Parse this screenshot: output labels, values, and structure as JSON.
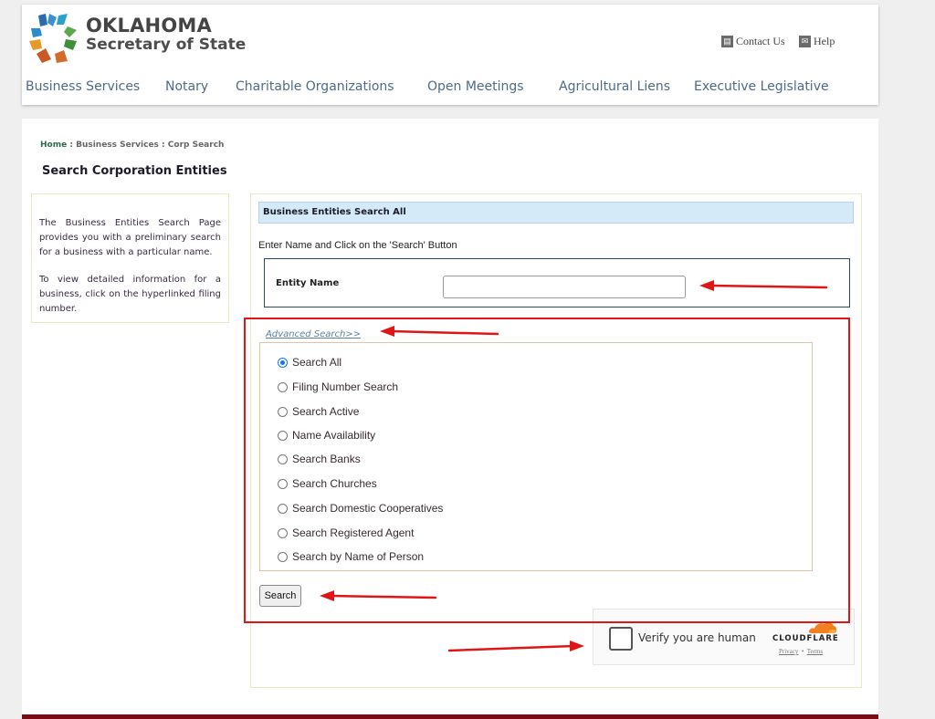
{
  "header": {
    "brand_line1": "OKLAHOMA",
    "brand_line2": "Secretary of State",
    "utility_links": [
      {
        "label": "Contact Us",
        "icon": "contact-icon"
      },
      {
        "label": "Help",
        "icon": "mail-icon"
      }
    ],
    "nav": [
      "Business Services",
      "Notary",
      "Charitable Organizations",
      "Open Meetings",
      "Agricultural Liens",
      "Executive Legislative"
    ]
  },
  "breadcrumb": {
    "home": "Home",
    "sep": " : ",
    "section": "Business Services",
    "current": "Corp Search"
  },
  "page_title": "Search Corporation Entities",
  "sidebar": {
    "para1": "The Business Entities Search Page provides you with a preliminary search for a business with a particular name.",
    "para2": "To view detailed information for a business, click on the hyperlinked filing number."
  },
  "search_panel": {
    "heading": "Business Entities Search All",
    "instructions": "Enter Name and Click on the 'Search' Button",
    "entity_label": "Entity Name",
    "entity_value": "",
    "advanced_link": "Advanced Search>>",
    "options": [
      {
        "label": "Search All",
        "selected": true
      },
      {
        "label": "Filing Number Search",
        "selected": false
      },
      {
        "label": "Search Active",
        "selected": false
      },
      {
        "label": "Name Availability",
        "selected": false
      },
      {
        "label": "Search Banks",
        "selected": false
      },
      {
        "label": "Search Churches",
        "selected": false
      },
      {
        "label": "Search Domestic Cooperatives",
        "selected": false
      },
      {
        "label": "Search Registered Agent",
        "selected": false
      },
      {
        "label": "Search by Name of Person",
        "selected": false
      }
    ],
    "search_button": "Search"
  },
  "captcha": {
    "label": "Verify you are human",
    "provider": "CLOUDFLARE",
    "privacy": "Privacy",
    "dot": "•",
    "terms": "Terms"
  },
  "colors": {
    "annotation": "#e01616",
    "nav_text": "#4d6a8c",
    "panel_header": "#d5eaf8",
    "footer": "#7b0a14",
    "radio_selected": "#1a73e8"
  }
}
